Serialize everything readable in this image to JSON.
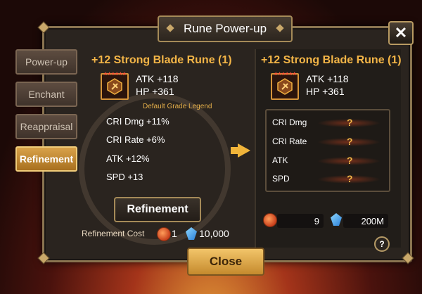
{
  "title": "Rune Power-up",
  "close_icon_label": "✕",
  "tabs": [
    {
      "label": "Power-up",
      "active": false
    },
    {
      "label": "Enchant",
      "active": false
    },
    {
      "label": "Reappraisal",
      "active": false
    },
    {
      "label": "Refinement",
      "active": true
    }
  ],
  "left": {
    "rune_name": "+12 Strong Blade Rune (1)",
    "stars": "★★★★★★",
    "main_stat": "ATK +118",
    "innate_stat": "HP +361",
    "legend": "Default Grade Legend",
    "sub_stats": [
      "CRI Dmg +11%",
      "CRI Rate +6%",
      "ATK +12%",
      "SPD +13"
    ],
    "refine_button": "Refinement",
    "cost_label": "Refinement Cost",
    "cost_runes": "1",
    "cost_mana": "10,000"
  },
  "right": {
    "rune_name": "+12 Strong Blade Rune (1)",
    "stars": "★★★★★★",
    "main_stat": "ATK +118",
    "innate_stat": "HP +361",
    "unknown_stats": [
      {
        "label": "CRI Dmg",
        "value": "?"
      },
      {
        "label": "CRI Rate",
        "value": "?"
      },
      {
        "label": "ATK",
        "value": "?"
      },
      {
        "label": "SPD",
        "value": "?"
      }
    ],
    "owned_runes": "9",
    "owned_mana": "200M",
    "help_label": "?"
  },
  "close_button": "Close",
  "colors": {
    "accent": "#f3b547",
    "frame": "#8a7450",
    "active_tab": "#d9a24a"
  }
}
